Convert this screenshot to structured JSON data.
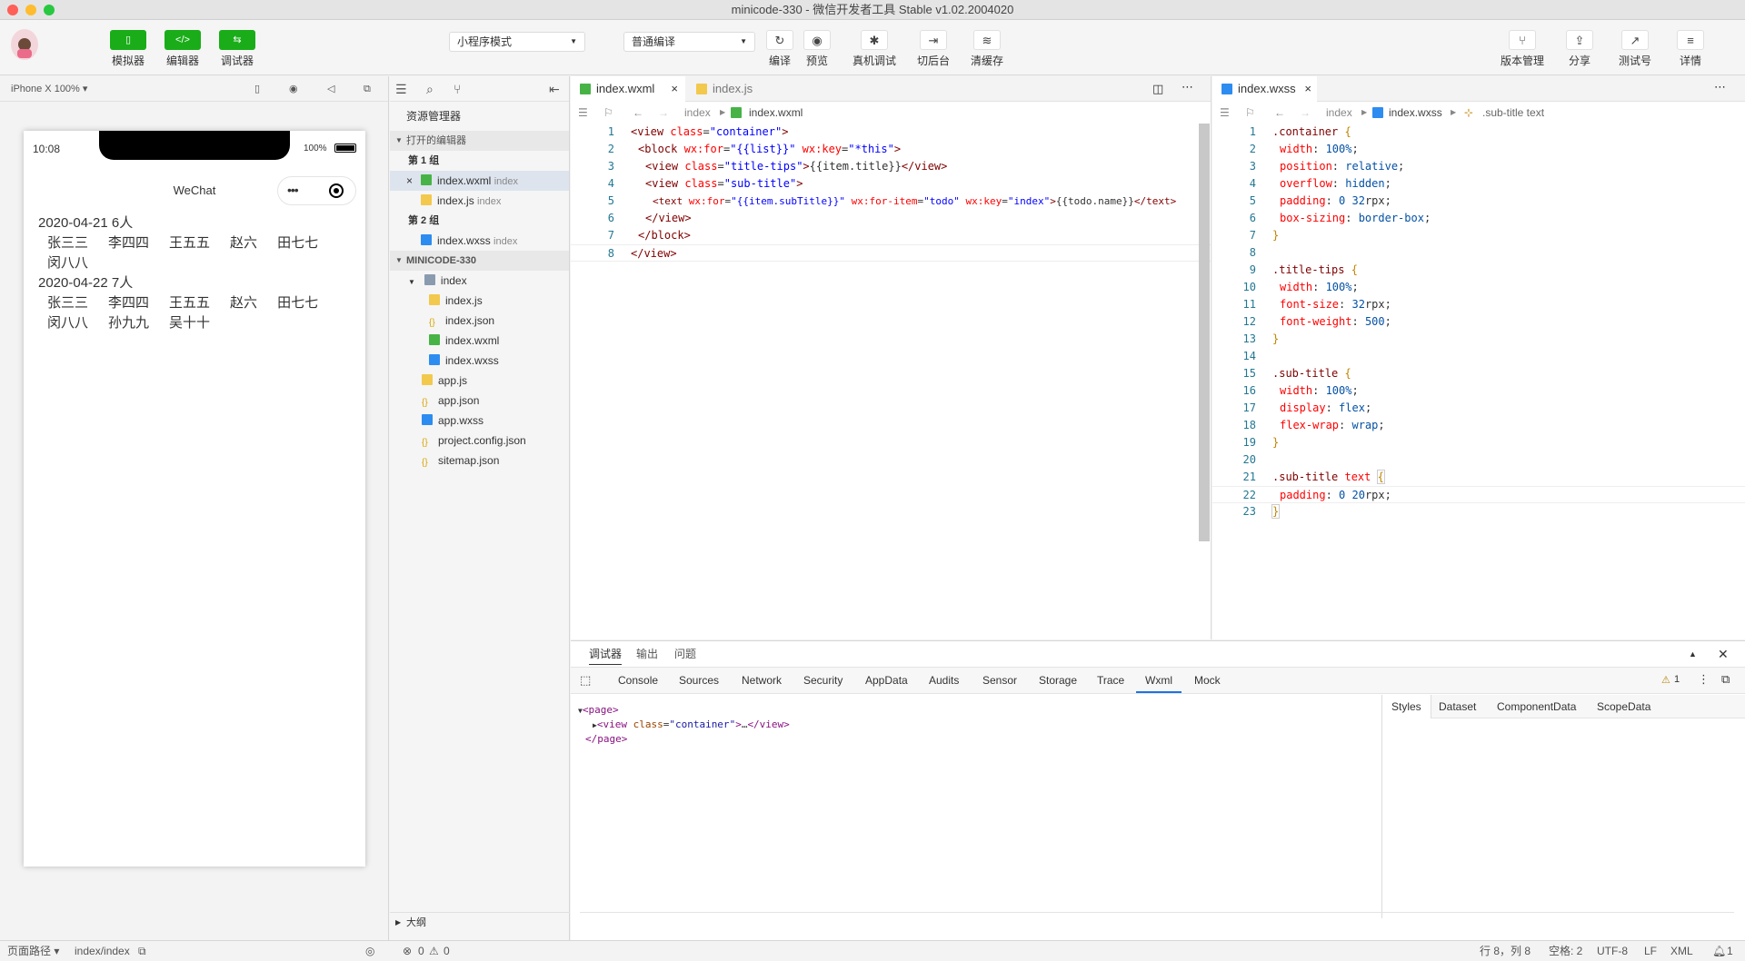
{
  "window": {
    "title": "minicode-330 - 微信开发者工具 Stable v1.02.2004020"
  },
  "toolbar": {
    "simulator": "模拟器",
    "editor": "编辑器",
    "debugger": "调试器",
    "mode": "小程序模式",
    "compile_mode": "普通编译",
    "compile": "编译",
    "preview": "预览",
    "real_debug": "真机调试",
    "background": "切后台",
    "clear_cache": "清缓存",
    "version": "版本管理",
    "share": "分享",
    "test_account": "测试号",
    "details": "详情",
    "accent": "#1aad19"
  },
  "simulator": {
    "device": "iPhone X 100% ▾",
    "time": "10:08",
    "battery": "100%",
    "nav_title": "WeChat",
    "capsule_dots": "•••",
    "groups": [
      {
        "date": "2020-04-21 6人",
        "names": [
          "张三三",
          "李四四",
          "王五五",
          "赵六",
          "田七七",
          "闵八八"
        ]
      },
      {
        "date": "2020-04-22 7人",
        "names": [
          "张三三",
          "李四四",
          "王五五",
          "赵六",
          "田七七",
          "闵八八",
          "孙九九",
          "吴十十"
        ]
      }
    ]
  },
  "files": {
    "title": "资源管理器",
    "open_editors": "打开的编辑器",
    "group1": "第 1 组",
    "group2": "第 2 组",
    "open": [
      {
        "name": "index.wxml",
        "hint": "index"
      },
      {
        "name": "index.js",
        "hint": "index"
      },
      {
        "name": "index.wxss",
        "hint": "index"
      }
    ],
    "project": "MINICODE-330",
    "folder": "index",
    "folder_files": [
      "index.js",
      "index.json",
      "index.wxml",
      "index.wxss"
    ],
    "root_files": [
      "app.js",
      "app.json",
      "app.wxss",
      "project.config.json",
      "sitemap.json"
    ],
    "outline": "大纲"
  },
  "editor1": {
    "tabs": [
      "index.wxml",
      "index.js"
    ],
    "breadcrumb": [
      "index",
      "index.wxml"
    ],
    "lines": [
      "1",
      "2",
      "3",
      "4",
      "5",
      "6",
      "7",
      "8"
    ]
  },
  "editor2": {
    "tab": "index.wxss",
    "breadcrumb": [
      "index",
      "index.wxss",
      ".sub-title text"
    ],
    "lines": [
      "1",
      "2",
      "3",
      "4",
      "5",
      "6",
      "7",
      "8",
      "9",
      "10",
      "11",
      "12",
      "13",
      "14",
      "15",
      "16",
      "17",
      "18",
      "19",
      "20",
      "21",
      "22",
      "23"
    ]
  },
  "debugger": {
    "top_tabs": [
      "调试器",
      "输出",
      "问题"
    ],
    "tabs": [
      "Console",
      "Sources",
      "Network",
      "Security",
      "AppData",
      "Audits",
      "Sensor",
      "Storage",
      "Trace",
      "Wxml",
      "Mock"
    ],
    "active_tab": "Wxml",
    "warnings": "1",
    "styles_tabs": [
      "Styles",
      "Dataset",
      "ComponentData",
      "ScopeData"
    ],
    "tree": {
      "page_open": "<page>",
      "view_tag": "view",
      "view_attr": "class",
      "view_val": "container",
      "view_close": "</view>",
      "page_close": "</page>"
    }
  },
  "status": {
    "path_label": "页面路径 ▾",
    "path": "index/index",
    "errors": "0",
    "warnings": "0",
    "cursor": "行 8，列 8",
    "spaces": "空格: 2",
    "encoding": "UTF-8",
    "eol": "LF",
    "lang": "XML",
    "notifications": "1"
  }
}
